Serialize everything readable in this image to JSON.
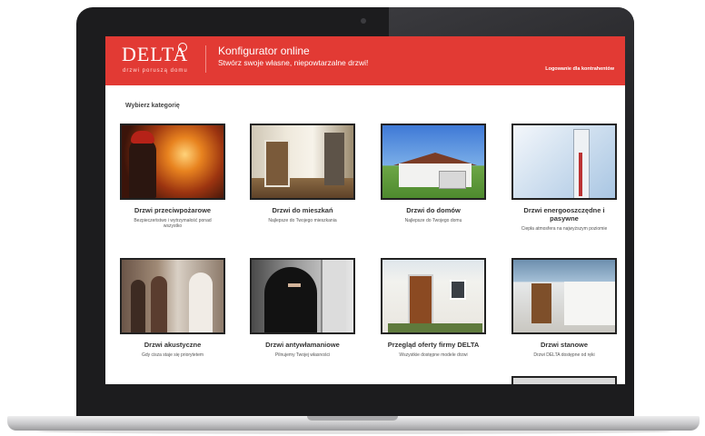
{
  "header": {
    "logo_text": "DELTA",
    "logo_tagline": "drzwi poruszą domu",
    "title": "Konfigurator online",
    "subtitle": "Stwórz swoje własne, niepowtarzalne drzwi!",
    "login_link": "Logowanie dla kontrahentów"
  },
  "main": {
    "heading": "Wybierz kategorię",
    "categories": [
      {
        "title": "Drzwi przeciwpożarowe",
        "desc": "Bezpieczeństwo i wytrzymałość ponad wszystko"
      },
      {
        "title": "Drzwi do mieszkań",
        "desc": "Najlepsze do Twojego mieszkania"
      },
      {
        "title": "Drzwi do domów",
        "desc": "Najlepsze do Twojego domu"
      },
      {
        "title": "Drzwi energooszczędne i pasywne",
        "desc": "Ciepła atmosfera na najwyższym poziomie"
      },
      {
        "title": "Drzwi akustyczne",
        "desc": "Gdy cisza staje się priorytetem"
      },
      {
        "title": "Drzwi antywłamaniowe",
        "desc": "Pilnujemy Twojej własności"
      },
      {
        "title": "Przegląd oferty firmy DELTA",
        "desc": "Wszystkie dostępne modele drzwi"
      },
      {
        "title": "Drzwi stanowe",
        "desc": "Drzwi DELTA dostępne od ręki"
      }
    ]
  },
  "colors": {
    "brand_red": "#e23a34"
  }
}
